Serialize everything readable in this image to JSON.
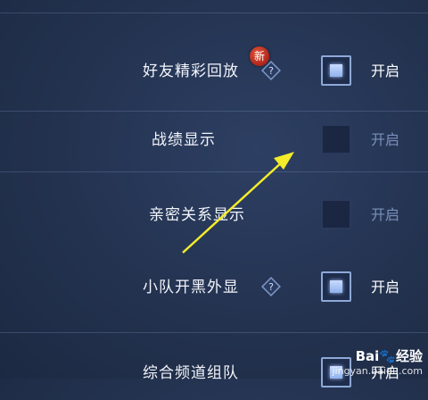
{
  "settings": [
    {
      "label": "好友精彩回放",
      "checked": true,
      "state": "开启",
      "has_help": true,
      "badge": "新"
    },
    {
      "label": "战绩显示",
      "checked": false,
      "state": "开启",
      "has_help": false
    },
    {
      "label": "亲密关系显示",
      "checked": false,
      "state": "开启",
      "has_help": false
    },
    {
      "label": "小队开黑外显",
      "checked": true,
      "state": "开启",
      "has_help": true
    },
    {
      "label": "综合频道组队",
      "checked": true,
      "state": "开启",
      "has_help": false
    }
  ],
  "watermark": {
    "brand": "Bai",
    "brand2": "经验",
    "url": "jingyan.baidu.com"
  },
  "colors": {
    "arrow": "#f4ec2a",
    "accent": "#8fb1ec",
    "badge": "#c0301f"
  }
}
